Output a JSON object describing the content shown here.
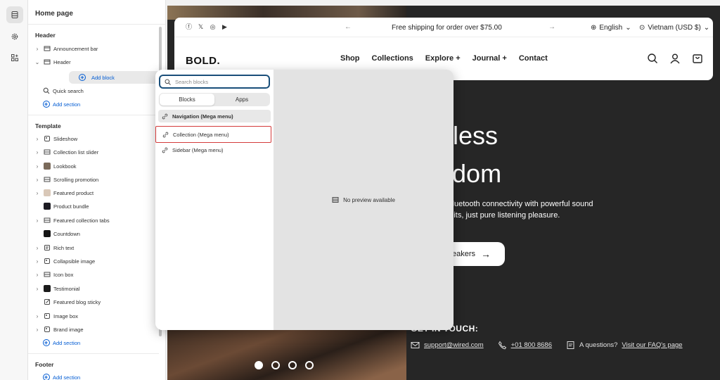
{
  "sidebar": {
    "title": "Home page",
    "header_section": {
      "label": "Header",
      "items": [
        {
          "label": "Announcement bar"
        },
        {
          "label": "Header"
        }
      ],
      "add_block": "Add block",
      "quick_search": "Quick search",
      "add_section": "Add section"
    },
    "template_section": {
      "label": "Template",
      "items": [
        {
          "label": "Slideshow"
        },
        {
          "label": "Collection list slider"
        },
        {
          "label": "Lookbook"
        },
        {
          "label": "Scrolling promotion"
        },
        {
          "label": "Featured product"
        },
        {
          "label": "Product bundle"
        },
        {
          "label": "Featured collection tabs"
        },
        {
          "label": "Countdown"
        },
        {
          "label": "Rich text"
        },
        {
          "label": "Collapsible image"
        },
        {
          "label": "Icon box"
        },
        {
          "label": "Testimonial"
        },
        {
          "label": "Featured blog sticky"
        },
        {
          "label": "Image box"
        },
        {
          "label": "Brand image"
        }
      ],
      "add_section": "Add section"
    },
    "footer_section": {
      "label": "Footer",
      "add_section": "Add section"
    }
  },
  "picker": {
    "search_placeholder": "Search blocks",
    "tabs": [
      "Blocks",
      "Apps"
    ],
    "blocks": [
      {
        "label": "Navigation (Mega menu)"
      },
      {
        "label": "Collection (Mega menu)"
      },
      {
        "label": "Sidebar (Mega menu)"
      }
    ],
    "no_preview": "No preview available"
  },
  "store": {
    "announcement": "Free shipping for order over $75.00",
    "language": "English",
    "country": "Vietnam (USD $)",
    "logo": "BOLD.",
    "menu": [
      "Shop",
      "Collections",
      "Explore +",
      "Journal +",
      "Contact"
    ],
    "hero_line1": "eless",
    "hero_line2": "edom",
    "hero_desc1": "ess Bluetooth connectivity with powerful sound",
    "hero_desc2": "no limits, just pure listening pleasure.",
    "hero_button": "eakers",
    "get_in_touch": "GET IN TOUCH:",
    "email": "support@wired.com",
    "phone": "+01 800 8686",
    "questions": "A questions?",
    "faq_link": "Visit our FAQ's page"
  }
}
